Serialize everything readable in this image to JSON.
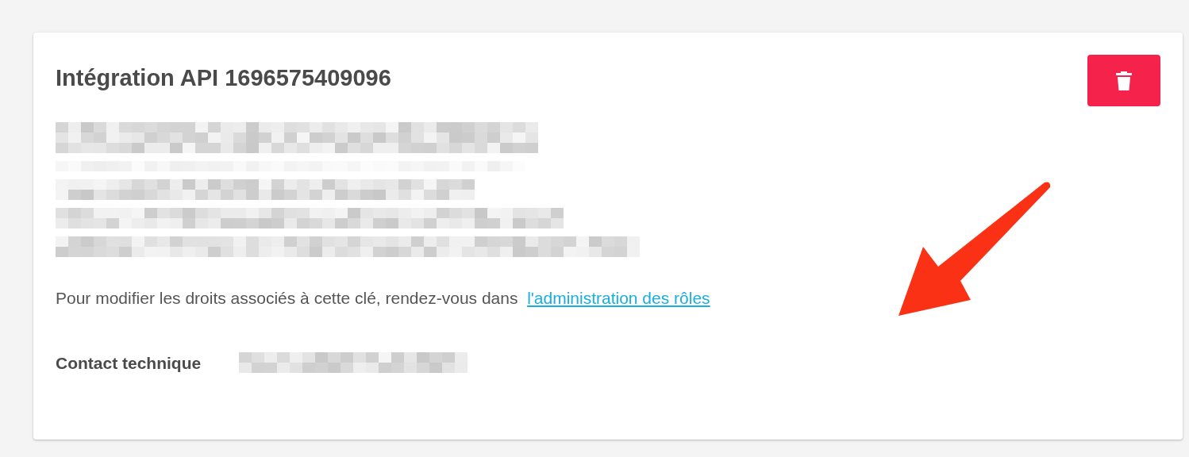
{
  "card": {
    "title": "Intégration API 1696575409096",
    "rights_note": {
      "text": "Pour modifier les droits associés à cette clé, rendez-vous dans",
      "link": "l'administration des rôles"
    },
    "contact": {
      "label": "Contact technique"
    }
  }
}
